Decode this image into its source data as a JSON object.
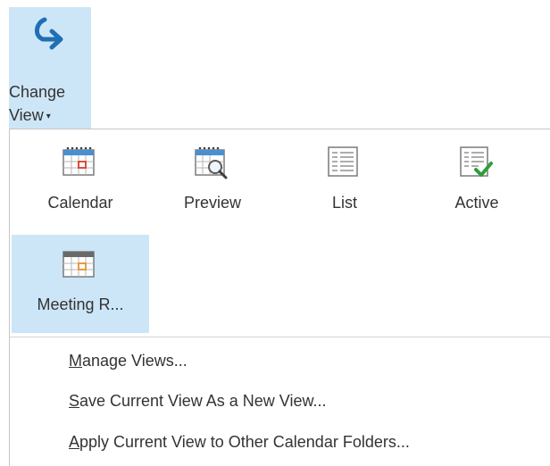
{
  "ribbon_button": {
    "icon": "change-view-arrow-icon",
    "label_line1": "Change",
    "label_line2": "View",
    "caret": "▾",
    "accent": "#1f6fb5",
    "highlight": "#cde6f7"
  },
  "views": [
    {
      "label": "Calendar",
      "icon": "calendar-view-icon",
      "selected": false
    },
    {
      "label": "Preview",
      "icon": "preview-view-icon",
      "selected": false
    },
    {
      "label": "List",
      "icon": "list-view-icon",
      "selected": false
    },
    {
      "label": "Active",
      "icon": "active-view-icon",
      "selected": false
    },
    {
      "label": "Meeting R...",
      "icon": "meeting-requests-view-icon",
      "selected": true
    }
  ],
  "menu": [
    {
      "accel": "M",
      "rest": "anage Views..."
    },
    {
      "accel": "S",
      "rest": "ave Current View As a New View..."
    },
    {
      "accel": "A",
      "rest": "pply Current View to Other Calendar Folders..."
    }
  ]
}
